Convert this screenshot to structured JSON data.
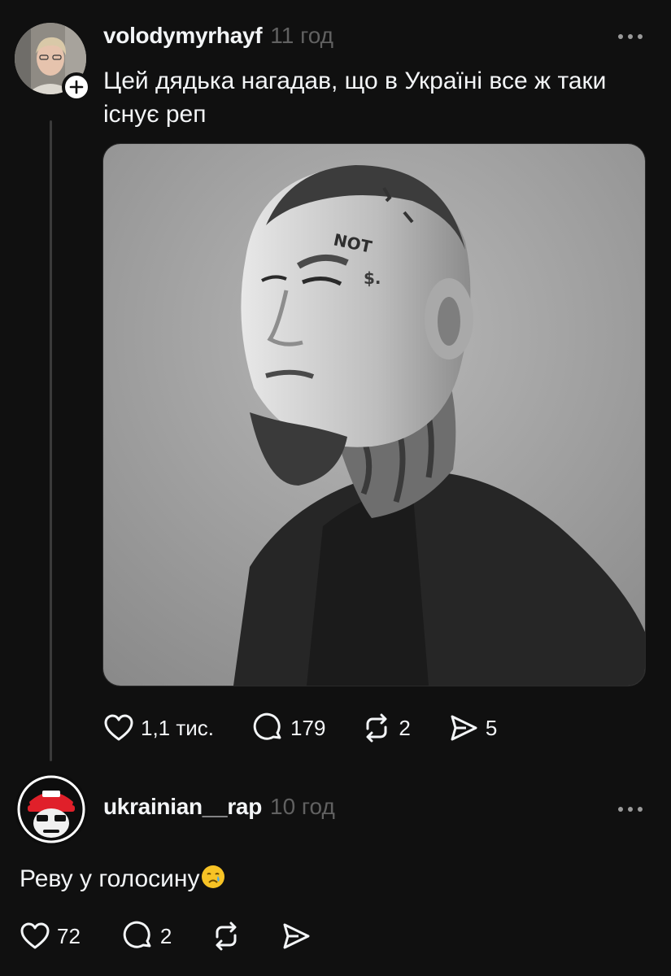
{
  "post": {
    "username": "volodymyrhayf",
    "time": "11 год",
    "text": "Цей дядька нагадав, що в Україні все ж таки існує реп",
    "actions": {
      "likes": "1,1 тис.",
      "comments": "179",
      "reposts": "2",
      "shares": "5"
    }
  },
  "reply": {
    "username": "ukrainian__rap",
    "time": "10 год",
    "text": "Реву у голосину",
    "emoji": "crying-face-emoji",
    "actions": {
      "likes": "72",
      "comments": "2"
    }
  },
  "colors": {
    "background": "#101010",
    "text": "#f3f5f7",
    "muted": "#616161",
    "thread_line": "#3a3a3a",
    "brand_red": "#e0202a"
  },
  "icons": [
    "more-icon",
    "plus-icon",
    "heart-icon",
    "comment-icon",
    "repost-icon",
    "share-icon"
  ]
}
